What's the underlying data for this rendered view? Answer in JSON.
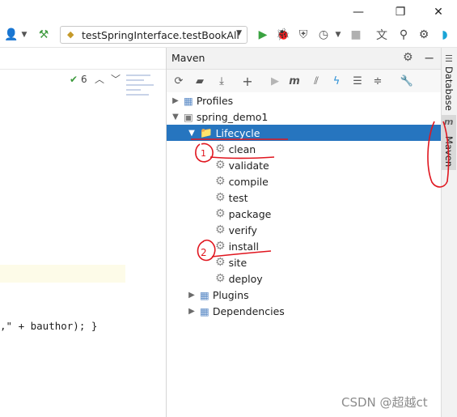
{
  "toolbar": {
    "run_config": "testSpringInterface.testBookAll",
    "icons": [
      "user-icon",
      "dropdown-icon",
      "hammer-icon",
      "run-icon",
      "debug-icon",
      "coverage-icon",
      "profile-icon",
      "stop-icon",
      "translate-icon",
      "search-icon",
      "settings-icon",
      "plugin-icon"
    ]
  },
  "window": {
    "minimize": "—",
    "restore": "❐",
    "close": "✕"
  },
  "editor": {
    "inspection_count": "6",
    "code_fragment": ",\" + bauthor); }"
  },
  "maven": {
    "title": "Maven",
    "tree": {
      "profiles": "Profiles",
      "project": "spring_demo1",
      "lifecycle": "Lifecycle",
      "goals": [
        "clean",
        "validate",
        "compile",
        "test",
        "package",
        "verify",
        "install",
        "site",
        "deploy"
      ],
      "plugins": "Plugins",
      "dependencies": "Dependencies"
    }
  },
  "right_tabs": {
    "database": "Database",
    "maven": "Maven"
  },
  "annotations": {
    "one": "1",
    "two": "2"
  },
  "watermark": "CSDN @超越ct",
  "colors": {
    "selection": "#2675bf",
    "annotation": "#e0161f"
  }
}
